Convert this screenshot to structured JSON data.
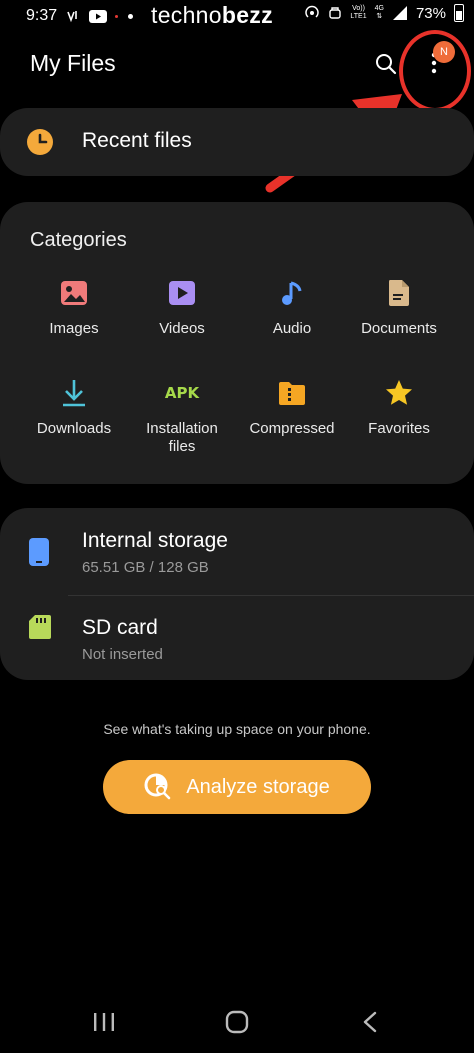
{
  "status_bar": {
    "time": "9:37",
    "volte": "Vo))",
    "lte": "LTE1",
    "net4g": "4G",
    "battery": "73%"
  },
  "watermark": {
    "prefix": "techno",
    "suffix": "bezz"
  },
  "app_bar": {
    "title": "My Files",
    "avatar_letter": "N"
  },
  "recent": {
    "label": "Recent files"
  },
  "categories": {
    "heading": "Categories",
    "items": [
      {
        "label": "Images",
        "icon": "image-icon",
        "color": "#f07a7a"
      },
      {
        "label": "Videos",
        "icon": "play-icon",
        "color": "#a98ef2"
      },
      {
        "label": "Audio",
        "icon": "music-note-icon",
        "color": "#5c9bff"
      },
      {
        "label": "Documents",
        "icon": "document-icon",
        "color": "#d9b98c"
      },
      {
        "label": "Downloads",
        "icon": "download-icon",
        "color": "#4fc3d9"
      },
      {
        "label": "Installation files",
        "icon": "apk-icon",
        "icon_text": "APK",
        "color": "#a6d94a"
      },
      {
        "label": "Compressed",
        "icon": "archive-icon",
        "color": "#f5a623"
      },
      {
        "label": "Favorites",
        "icon": "star-icon",
        "color": "#f6c624"
      }
    ]
  },
  "storage": [
    {
      "title": "Internal storage",
      "subtitle": "65.51 GB / 128 GB",
      "icon": "phone-icon",
      "color": "#5c9bff"
    },
    {
      "title": "SD card",
      "subtitle": "Not inserted",
      "icon": "sd-card-icon",
      "color": "#b8d95a"
    }
  ],
  "hint": "See what's taking up space on your phone.",
  "analyze_button": {
    "label": "Analyze storage",
    "color": "#f4a93b"
  },
  "annotation_color": "#e8322a"
}
